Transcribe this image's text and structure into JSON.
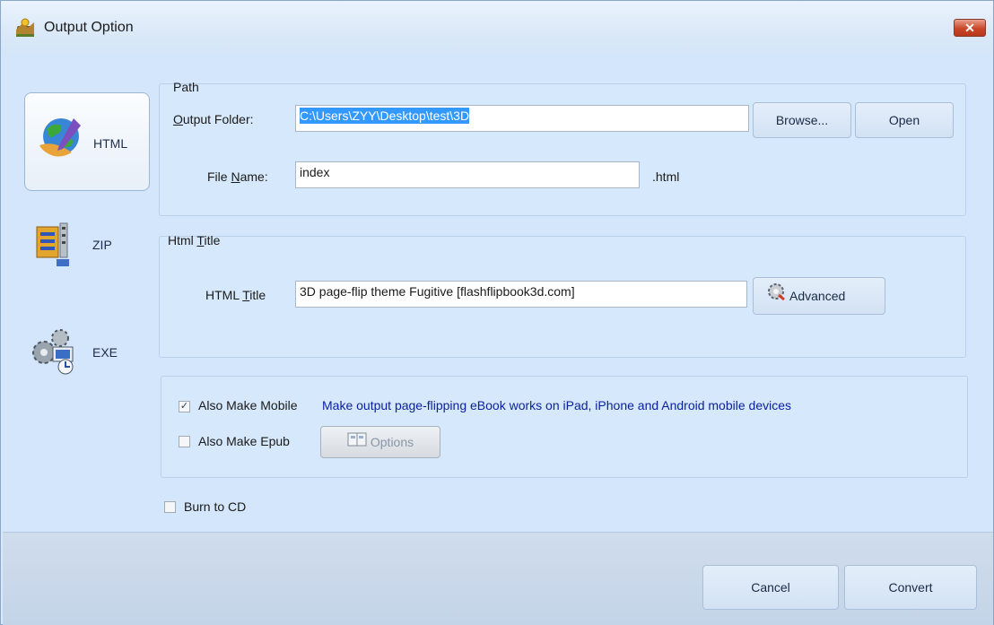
{
  "window": {
    "title": "Output Option",
    "close_label": "✕"
  },
  "nav": {
    "items": [
      {
        "label": "HTML",
        "selected": true
      },
      {
        "label": "ZIP",
        "selected": false
      },
      {
        "label": "EXE",
        "selected": false
      }
    ]
  },
  "path_group": {
    "title": "Path",
    "output_folder_label_pre": "",
    "output_folder_label_ul": "O",
    "output_folder_label_post": "utput Folder:",
    "output_folder_value": "C:\\Users\\ZYY\\Desktop\\test\\3D",
    "browse_label": "Browse...",
    "open_label": "Open",
    "file_name_label_pre": "File ",
    "file_name_label_ul": "N",
    "file_name_label_post": "ame:",
    "file_name_value": "index",
    "file_ext": ".html"
  },
  "title_group": {
    "title_pre": "Html ",
    "title_ul": "T",
    "title_post": "itle",
    "html_title_label_pre": "HTML ",
    "html_title_label_ul": "T",
    "html_title_label_post": "itle",
    "html_title_value": "3D page-flip theme Fugitive [flashflipbook3d.com]",
    "advanced_label": "Advanced"
  },
  "options_group": {
    "also_make_mobile_label": "Also Make Mobile",
    "also_make_mobile_checked": true,
    "mobile_description": "Make output page-flipping eBook works on iPad, iPhone and Android mobile devices",
    "also_make_epub_label": "Also Make Epub",
    "also_make_epub_checked": false,
    "options_label": "Options"
  },
  "burn_to_cd": {
    "label": "Burn to CD",
    "checked": false
  },
  "footer": {
    "cancel_label": "Cancel",
    "convert_label": "Convert"
  }
}
